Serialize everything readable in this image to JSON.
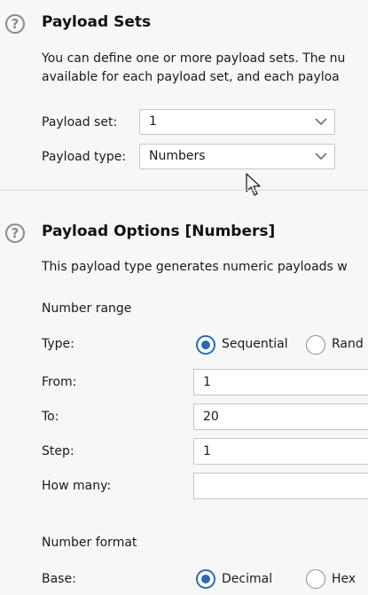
{
  "payload_sets": {
    "title": "Payload Sets",
    "description_line1": "You can define one or more payload sets. The nu",
    "description_line2": "available for each payload set, and each payloa",
    "set_label": "Payload set:",
    "set_value": "1",
    "type_label": "Payload type:",
    "type_value": "Numbers"
  },
  "payload_options": {
    "title": "Payload Options [Numbers]",
    "description": "This payload type generates numeric payloads w",
    "number_range": {
      "heading": "Number range",
      "type_label": "Type:",
      "type_options": [
        "Sequential",
        "Rand"
      ],
      "type_selected": "Sequential",
      "from_label": "From:",
      "from_value": "1",
      "to_label": "To:",
      "to_value": "20",
      "step_label": "Step:",
      "step_value": "1",
      "how_many_label": "How many:",
      "how_many_value": ""
    },
    "number_format": {
      "heading": "Number format",
      "base_label": "Base:",
      "base_options": [
        "Decimal",
        "Hex"
      ],
      "base_selected": "Decimal"
    }
  },
  "colors": {
    "accent": "#2a6ab0",
    "background": "#f7f7f7",
    "field_border": "#c6c6c6"
  },
  "icons": [
    "help-icon",
    "chevron-down-icon",
    "mouse-cursor-icon"
  ]
}
